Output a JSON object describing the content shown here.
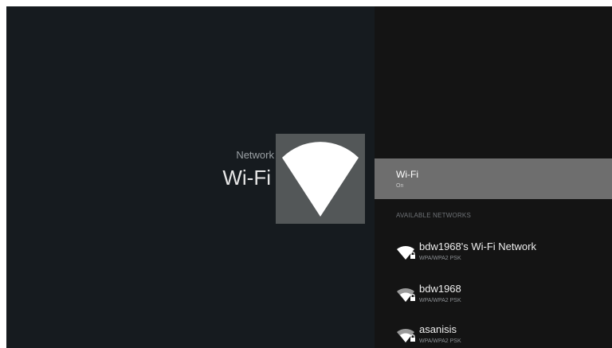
{
  "header": {
    "breadcrumb": "Network",
    "title": "Wi-Fi"
  },
  "hero_icon": "wifi-icon",
  "wifi_toggle": {
    "label": "Wi-Fi",
    "state": "On"
  },
  "networks_section": {
    "header": "AVAILABLE NETWORKS",
    "items": [
      {
        "name": "bdw1968's Wi-Fi Network",
        "security": "WPA/WPA2 PSK",
        "icon": "wifi-lock-icon"
      },
      {
        "name": "bdw1968",
        "security": "WPA/WPA2 PSK",
        "icon": "wifi-lock-icon"
      },
      {
        "name": "asanisis",
        "security": "WPA/WPA2 PSK",
        "icon": "wifi-lock-icon"
      }
    ]
  },
  "colors": {
    "background": "#161b1f",
    "panel": "#141414",
    "icon_box": "#535758",
    "selected_row": "#6e6e6e"
  }
}
